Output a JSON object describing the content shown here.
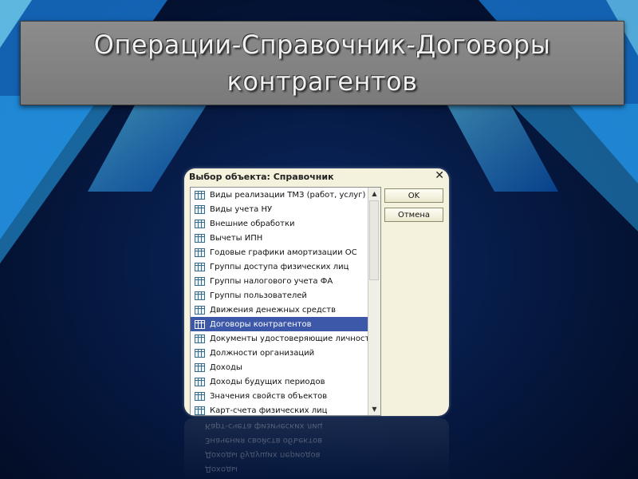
{
  "slide": {
    "title": "Операции-Справочник-Договоры контрагентов"
  },
  "dialog": {
    "title": "Выбор объекта: Справочник",
    "close_icon": "close-icon",
    "buttons": {
      "ok": "OK",
      "cancel": "Отмена"
    },
    "items": [
      {
        "label": "Виды реализации ТМЗ (работ, услуг)"
      },
      {
        "label": "Виды учета НУ"
      },
      {
        "label": "Внешние обработки"
      },
      {
        "label": "Вычеты ИПН"
      },
      {
        "label": "Годовые графики амортизации ОС"
      },
      {
        "label": "Группы доступа физических лиц"
      },
      {
        "label": "Группы налогового учета ФА"
      },
      {
        "label": "Группы пользователей"
      },
      {
        "label": "Движения денежных средств"
      },
      {
        "label": "Договоры контрагентов",
        "selected": true
      },
      {
        "label": "Документы удостоверяющие личность"
      },
      {
        "label": "Должности организаций"
      },
      {
        "label": "Доходы"
      },
      {
        "label": "Доходы будущих периодов"
      },
      {
        "label": "Значения свойств объектов"
      },
      {
        "label": "Карт-счета физических лиц"
      }
    ]
  },
  "colors": {
    "selection": "#3d58a8",
    "dialog_bg": "#f4f1dc",
    "title_box": "#808080"
  }
}
